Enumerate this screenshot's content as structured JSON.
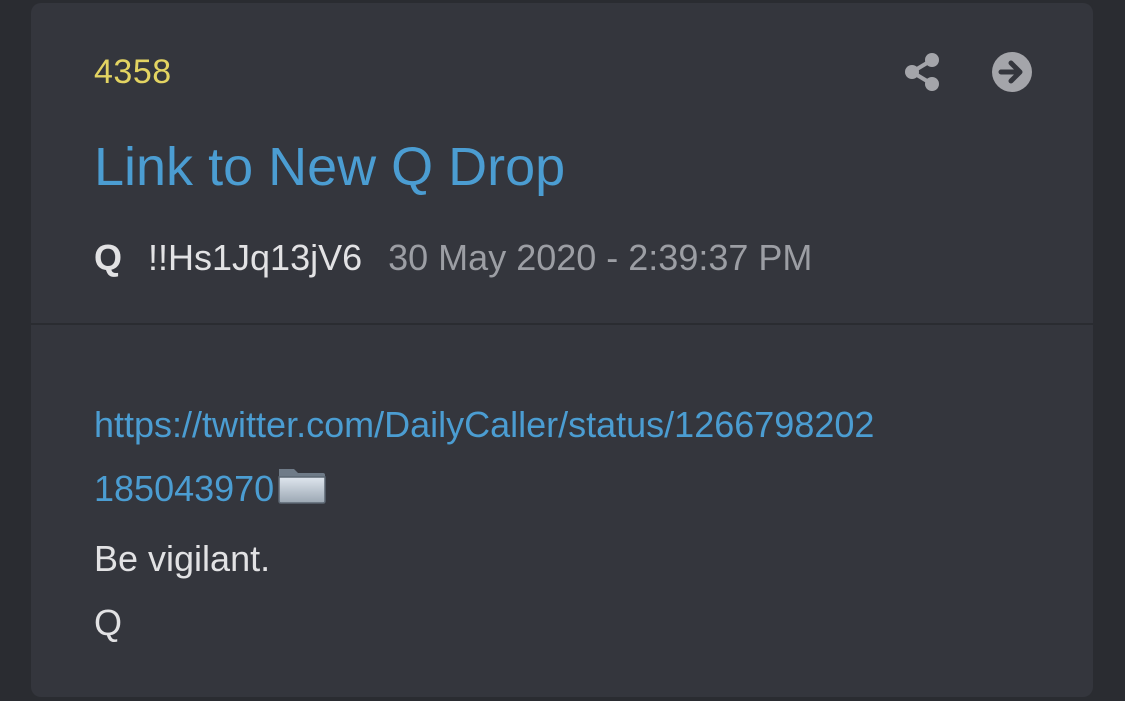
{
  "post": {
    "number": "4358",
    "title": "Link to New Q Drop",
    "author": "Q",
    "tripcode": "!!Hs1Jq13jV6",
    "timestamp": "30 May 2020 - 2:39:37 PM",
    "actions": {
      "share_icon": "share-icon",
      "open_icon": "arrow-right-circle-icon"
    },
    "body": {
      "link_line1": "https://twitter.com/DailyCaller/status/1266798202",
      "link_line2": "185043970",
      "folder_icon": "folder-icon",
      "lines": [
        "Be vigilant.",
        "Q"
      ]
    }
  },
  "colors": {
    "background": "#2a2c31",
    "card": "#34363d",
    "post_number": "#e3d462",
    "link": "#4b9dd2",
    "text": "#e2e2e4",
    "muted": "#9c9ea4",
    "icon": "#a4a5aa"
  }
}
